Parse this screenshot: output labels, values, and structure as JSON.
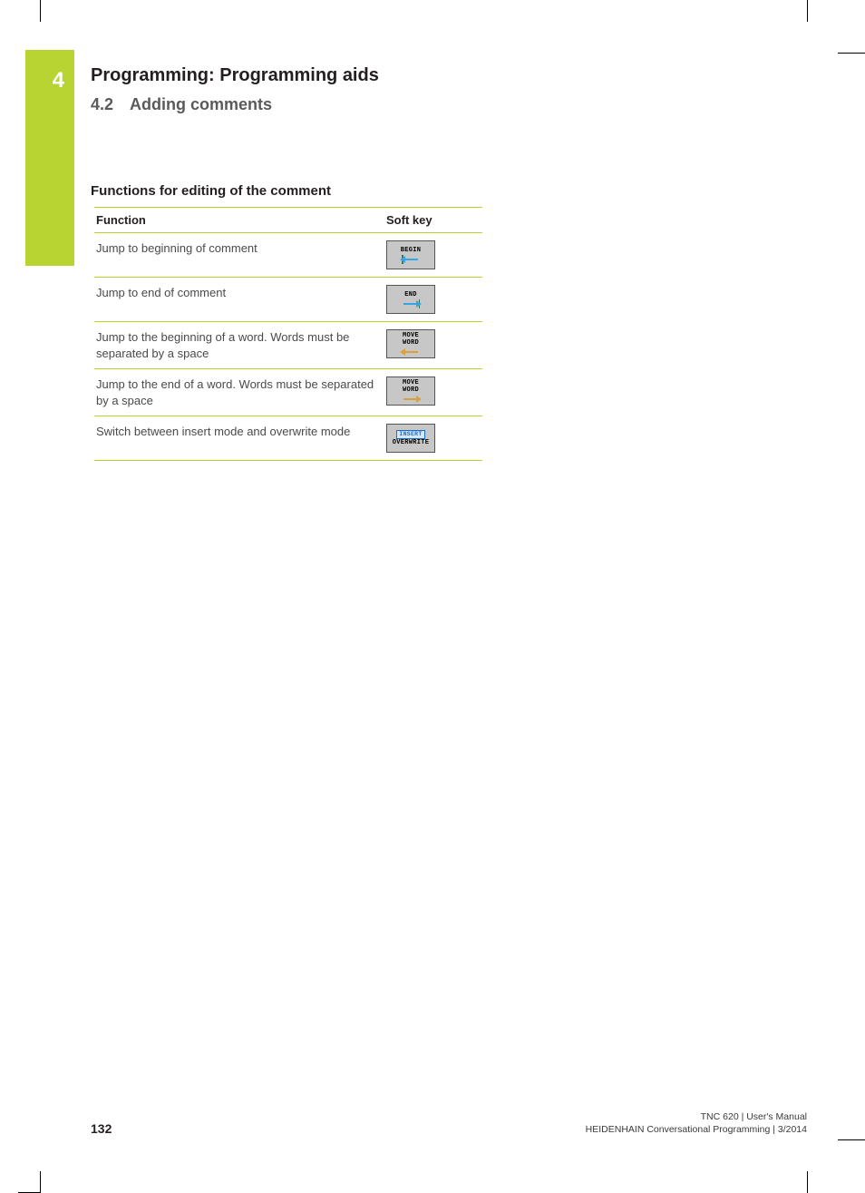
{
  "chapter_tab": "4",
  "chapter_title": "Programming: Programming aids",
  "section": {
    "number": "4.2",
    "title": "Adding comments"
  },
  "subsection_title": "Functions for editing of the comment",
  "table": {
    "headers": {
      "function": "Function",
      "softkey": "Soft key"
    },
    "rows": [
      {
        "function": "Jump to beginning of comment",
        "softkey": {
          "type": "begin",
          "lines": [
            "BEGIN"
          ]
        }
      },
      {
        "function": "Jump to end of comment",
        "softkey": {
          "type": "end",
          "lines": [
            "END"
          ]
        }
      },
      {
        "function": "Jump to the beginning of a word. Words must be separated by a space",
        "softkey": {
          "type": "move-word-left",
          "lines": [
            "MOVE",
            "WORD"
          ]
        }
      },
      {
        "function": "Jump to the end of a word. Words must be separated by a space",
        "softkey": {
          "type": "move-word-right",
          "lines": [
            "MOVE",
            "WORD"
          ]
        }
      },
      {
        "function": "Switch between insert mode and overwrite mode",
        "softkey": {
          "type": "insert-overwrite",
          "lines": [
            "INSERT",
            "OVERWRITE"
          ]
        }
      }
    ]
  },
  "footer": {
    "page": "132",
    "meta_line1": "TNC 620 | User's Manual",
    "meta_line2": "HEIDENHAIN Conversational Programming | 3/2014"
  }
}
